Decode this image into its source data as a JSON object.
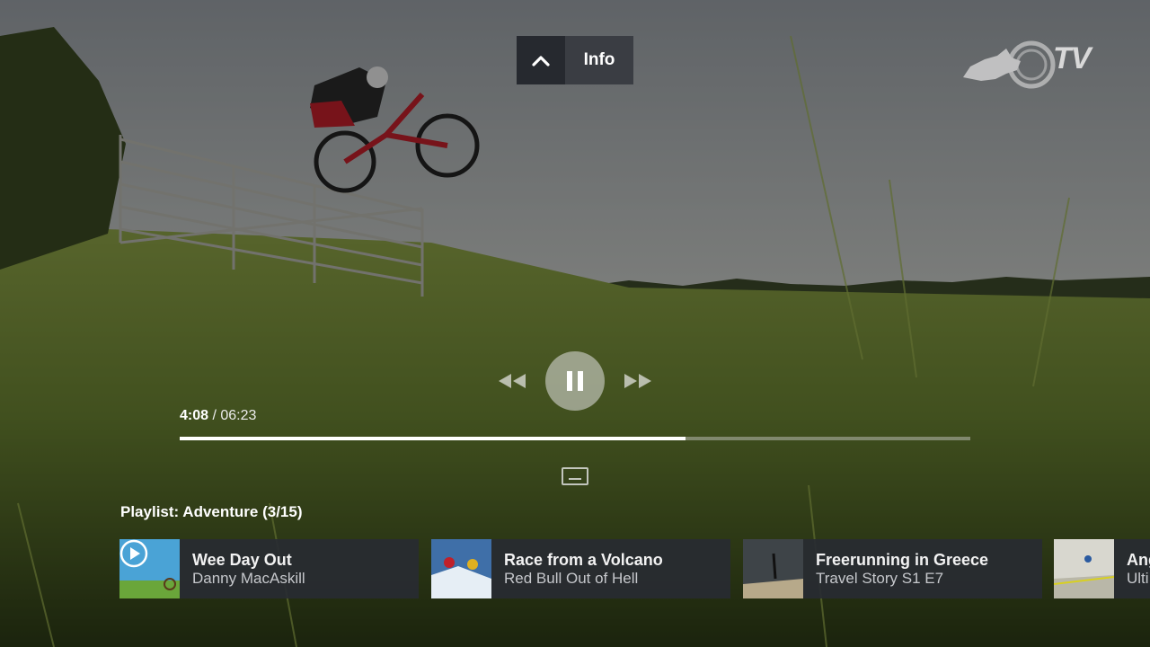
{
  "info_tab": {
    "label": "Info"
  },
  "logo": {
    "tv_text": "TV"
  },
  "player": {
    "current_time": "4:08",
    "total_time": "/ 06:23",
    "progress": 0.64
  },
  "playlist": {
    "title": "Playlist: Adventure (3/15)",
    "items": [
      {
        "title": "Wee Day Out",
        "subtitle": "Danny MacAskill",
        "now_playing": true
      },
      {
        "title": "Race from a Volcano",
        "subtitle": "Red Bull Out of Hell"
      },
      {
        "title": "Freerunning in Greece",
        "subtitle": "Travel Story S1 E7"
      },
      {
        "title": "Ang",
        "subtitle": "Ulti"
      }
    ]
  },
  "colors": {
    "card_bg": "#282b32",
    "info_dark": "#26292f",
    "info_light": "#3a3d43",
    "progress_fill": "#ffffff"
  }
}
